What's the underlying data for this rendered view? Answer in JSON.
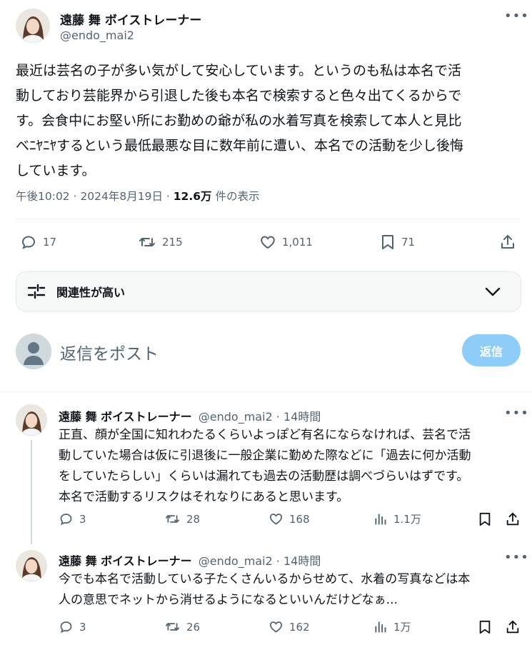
{
  "main": {
    "author_name": "遠藤 舞 ボイストレーナー",
    "author_handle": "@endo_mai2",
    "lines": [
      "最近は芸名の子が多い気がして安心しています。というのも私は本名で活",
      "動しており芸能界から引退した後も本名で検索すると色々出てくるからで",
      "す。会食中にお堅い所にお勤めの爺が私の水着写真を検索して本人と見比",
      "べﾆﾔﾆﾔするという最低最悪な目に数年前に遭い、本名での活動を少し後悔",
      "しています。"
    ],
    "timestamp": "午後10:02 · 2024年8月19日 · ",
    "views": "12.6万",
    "views_suffix": " 件の表示",
    "stats": {
      "replies": "17",
      "retweets": "215",
      "likes": "1,011",
      "bookmarks": "71"
    }
  },
  "sort": {
    "label": "関連性が高い"
  },
  "composer": {
    "placeholder": "返信をポスト",
    "button": "返信"
  },
  "replies": [
    {
      "name": "遠藤 舞 ボイストレーナー",
      "handle": "@endo_mai2",
      "time": "14時間",
      "lines": [
        "正直、顔が全国に知れわたるくらいよっぽど有名にならなければ、芸名で活",
        "動していた場合は仮に引退後に一般企業に勤めた際などに「過去に何か活動",
        "をしていたらしい」くらいは漏れても過去の活動歴は調べづらいはずです。",
        "本名で活動するリスクはそれなりにあると思います。"
      ],
      "stats": {
        "replies": "3",
        "retweets": "28",
        "likes": "168",
        "views": "1.1万"
      }
    },
    {
      "name": "遠藤 舞 ボイストレーナー",
      "handle": "@endo_mai2",
      "time": "14時間",
      "lines": [
        "今でも本名で活動している子たくさんいるからせめて、水着の写真などは本",
        "人の意思でネットから消せるようになるといいんだけどなぁ..."
      ],
      "stats": {
        "replies": "3",
        "retweets": "26",
        "likes": "162",
        "views": "1万"
      }
    }
  ],
  "colors": {
    "accent": "#1d9bf0",
    "reply_button": "#8ecdf8",
    "muted": "#536471",
    "text": "#0f1419"
  }
}
